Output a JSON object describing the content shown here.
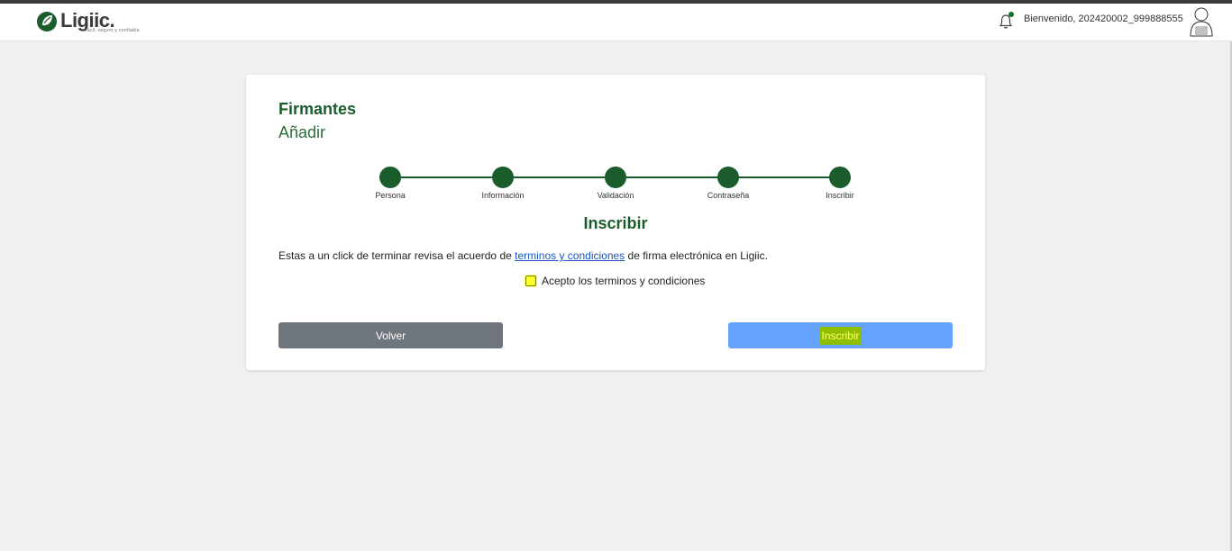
{
  "header": {
    "logo_text": "Ligiic.",
    "logo_tagline": "fácil, seguro y confiable",
    "welcome": "Bienvenido, 202420002_999888555",
    "accent": "#1a5c2b"
  },
  "card": {
    "title": "Firmantes",
    "subtitle": "Añadir",
    "steps": [
      {
        "label": "Persona"
      },
      {
        "label": "Información"
      },
      {
        "label": "Validación"
      },
      {
        "label": "Contraseña"
      },
      {
        "label": "Inscribir"
      }
    ],
    "section_title": "Inscribir",
    "description_before": "Estas a un click de terminar revisa el acuerdo de ",
    "terms_link": "terminos y condiciones",
    "description_after": " de firma electrónica en Ligiic.",
    "accept_label": "Acepto los terminos y condiciones",
    "accept_checked": false,
    "back_button": "Volver",
    "submit_button": "Inscribir"
  }
}
